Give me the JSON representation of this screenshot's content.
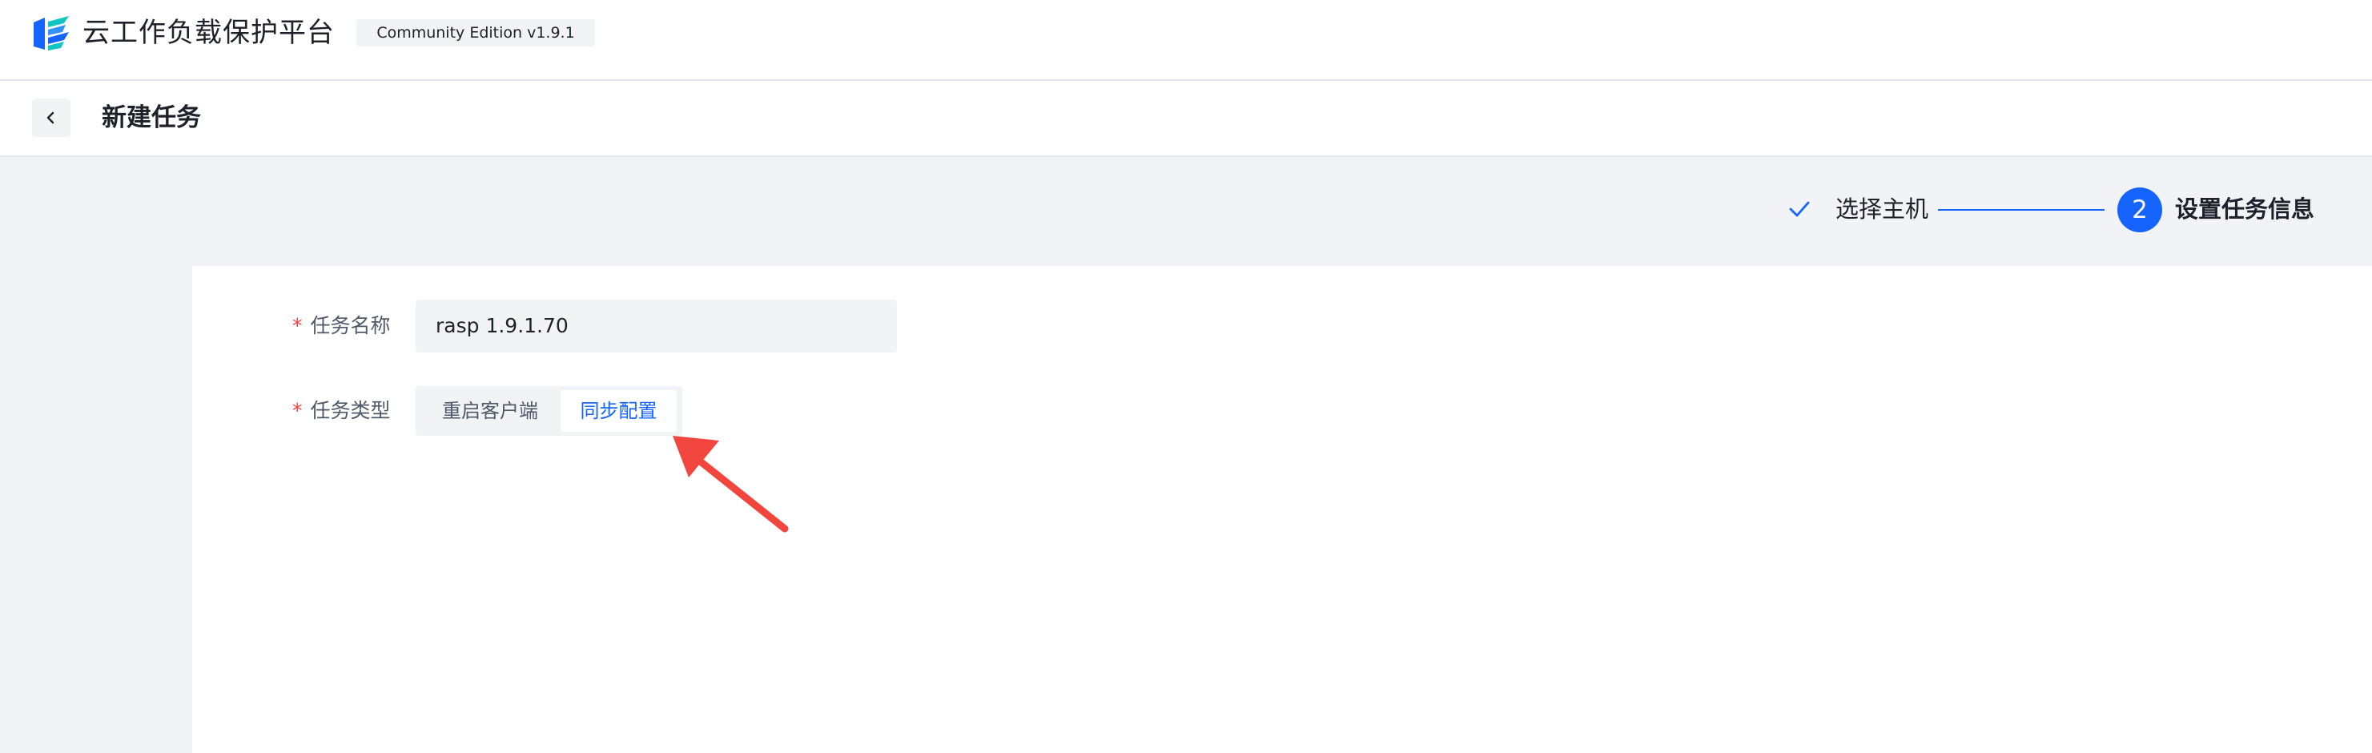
{
  "header": {
    "app_title": "云工作负载保护平台",
    "edition": "Community Edition v1.9.1",
    "logo_icon": "stacked-layers-logo",
    "brand_color": "#1664ff"
  },
  "page": {
    "back_icon": "chevron-left-icon",
    "title": "新建任务"
  },
  "steps": [
    {
      "label": "选择主机",
      "status": "done",
      "icon": "check-icon"
    },
    {
      "number": "2",
      "label": "设置任务信息",
      "status": "active"
    }
  ],
  "form": {
    "task_name": {
      "label": "任务名称",
      "required_mark": "*",
      "value": "rasp 1.9.1.70"
    },
    "task_type": {
      "label": "任务类型",
      "required_mark": "*",
      "options": [
        "重启客户端",
        "同步配置"
      ],
      "selected": "同步配置"
    }
  },
  "annotation": {
    "arrow_color": "#f2453d"
  }
}
